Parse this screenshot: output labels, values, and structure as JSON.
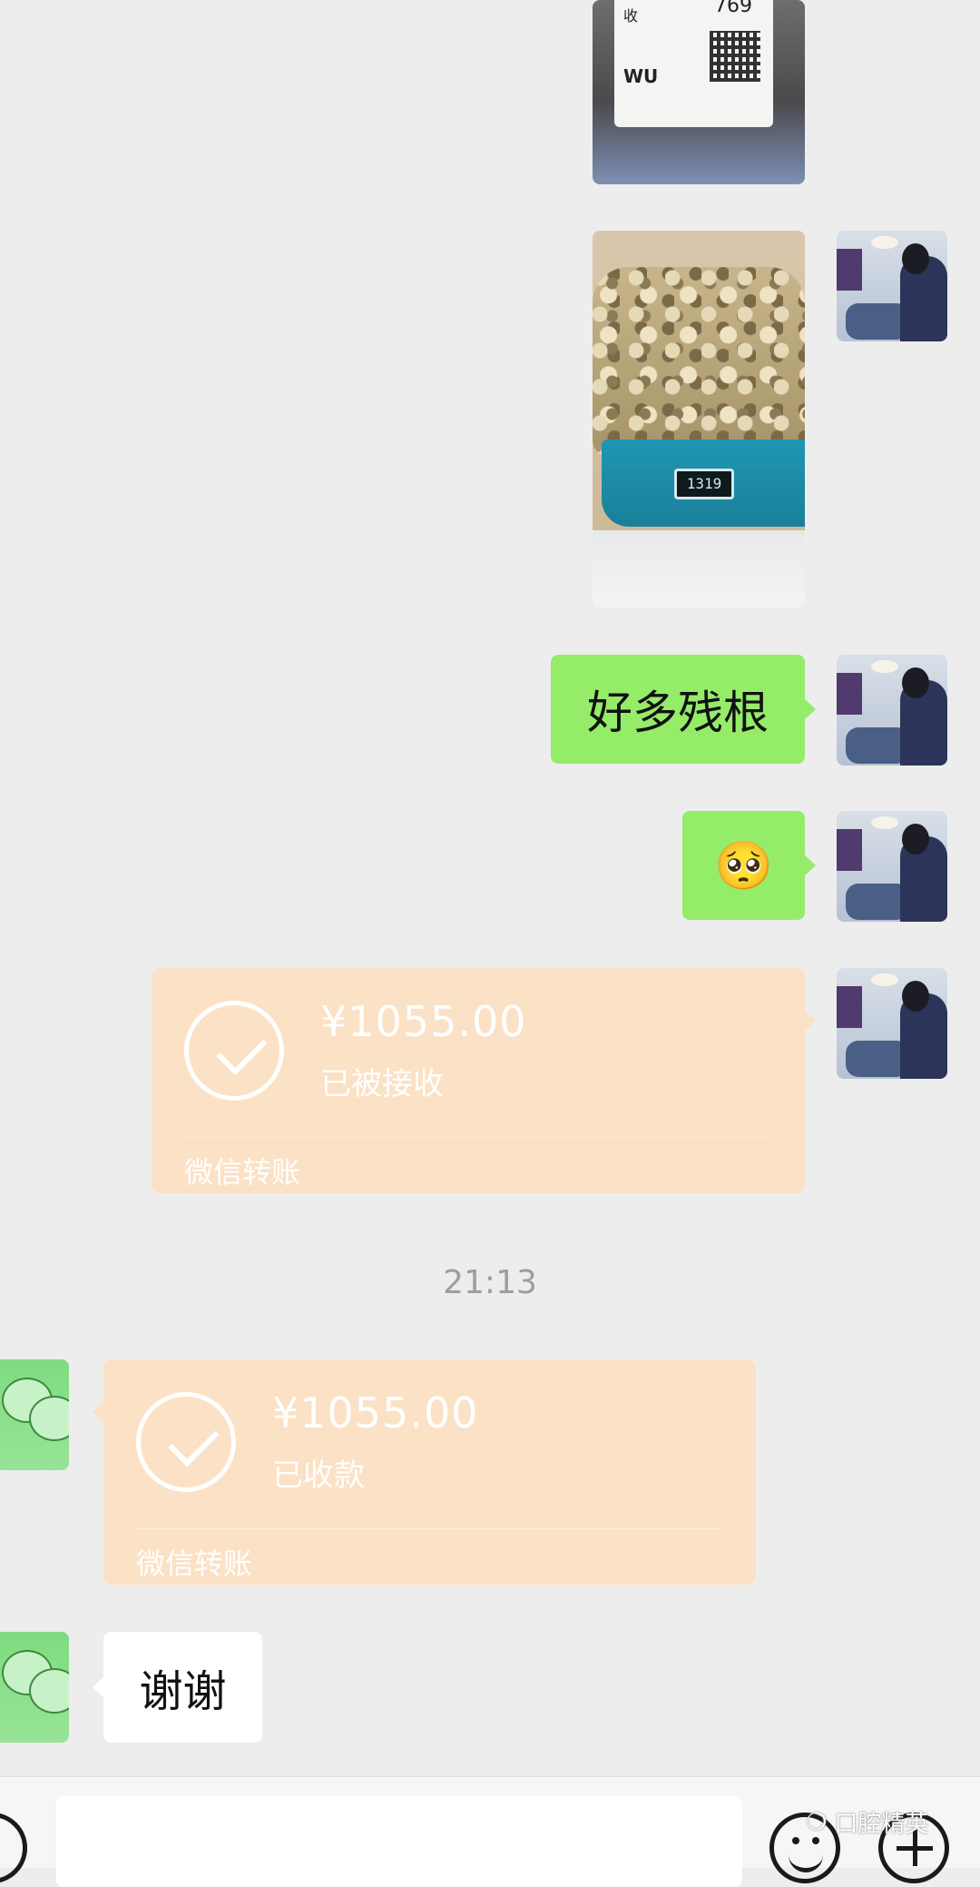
{
  "messages": {
    "text_1": "好多残根",
    "emoji_1": "🥺",
    "transfer_sent": {
      "amount": "¥1055.00",
      "status": "已被接收",
      "footer": "微信转账"
    },
    "timestamp": "21:13",
    "transfer_received": {
      "amount": "¥1055.00",
      "status": "已收款",
      "footer": "微信转账"
    },
    "reply_text": "谢谢"
  },
  "images": {
    "package_label_text": "收",
    "package_label_code": "769",
    "package_label_wu": "WU",
    "scale_reading": "1319"
  },
  "watermark": {
    "icon": "wechat-icon",
    "text": "口腔精英"
  },
  "bottom_bar": {
    "left_icon": "voice-icon",
    "emoji_icon": "emoji-icon",
    "plus_icon": "plus-icon"
  },
  "colors": {
    "chat_background": "#ededed",
    "sent_bubble": "#95ec69",
    "received_bubble": "#ffffff",
    "transfer_card": "#fbe1c5",
    "timestamp_text": "#9e9e9e"
  }
}
